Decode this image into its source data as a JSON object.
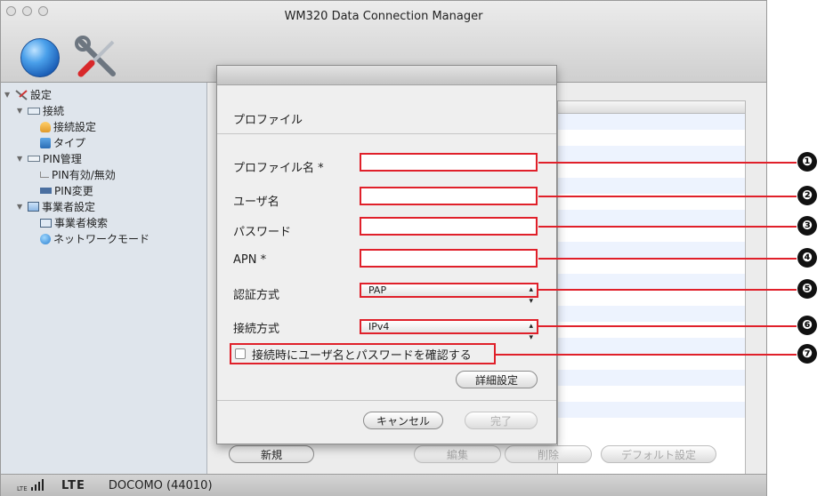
{
  "window": {
    "title": "WM320 Data Connection Manager"
  },
  "toolbar": {
    "items": [
      {
        "icon": "globe-icon"
      },
      {
        "icon": "tools-icon"
      }
    ]
  },
  "sidebar": {
    "items": [
      {
        "label": "設定",
        "icon": "settings-icon",
        "level": 0
      },
      {
        "label": "接続",
        "icon": "connection-icon",
        "level": 1
      },
      {
        "label": "接続設定",
        "icon": "person-icon",
        "level": 2
      },
      {
        "label": "タイプ",
        "icon": "type-icon",
        "level": 2
      },
      {
        "label": "PIN管理",
        "icon": "pin-icon",
        "level": 1
      },
      {
        "label": "PIN有効/無効",
        "icon": "pin-toggle-icon",
        "level": 2
      },
      {
        "label": "PIN変更",
        "icon": "pin-change-icon",
        "level": 2
      },
      {
        "label": "事業者設定",
        "icon": "monitor-icon",
        "level": 1
      },
      {
        "label": "事業者検索",
        "icon": "search-icon",
        "level": 2
      },
      {
        "label": "ネットワークモード",
        "icon": "network-icon",
        "level": 2
      }
    ]
  },
  "dialog": {
    "heading": "プロファイル",
    "fields": {
      "profile_name": {
        "label": "プロファイル名 *",
        "value": ""
      },
      "username": {
        "label": "ユーザ名",
        "value": ""
      },
      "password": {
        "label": "パスワード",
        "value": ""
      },
      "apn": {
        "label": "APN *",
        "value": ""
      }
    },
    "auth": {
      "label": "認証方式",
      "selected": "PAP"
    },
    "conn": {
      "label": "接続方式",
      "selected": "IPv4"
    },
    "confirm_checkbox": {
      "label": "接続時にユーザ名とパスワードを確認する",
      "checked": false
    },
    "advanced_button": "詳細設定",
    "cancel_button": "キャンセル",
    "done_button": "完了"
  },
  "main_buttons": {
    "new": "新規",
    "edit": "編集",
    "delete": "削除",
    "default": "デフォルト設定"
  },
  "statusbar": {
    "signal_label": "LTE",
    "network": "LTE",
    "carrier": "DOCOMO (44010)"
  },
  "callouts": [
    "❶",
    "❷",
    "❸",
    "❹",
    "❺",
    "❻",
    "❼"
  ],
  "colors": {
    "highlight": "#e0202a",
    "sidebar_bg": "#dfe5ec"
  }
}
